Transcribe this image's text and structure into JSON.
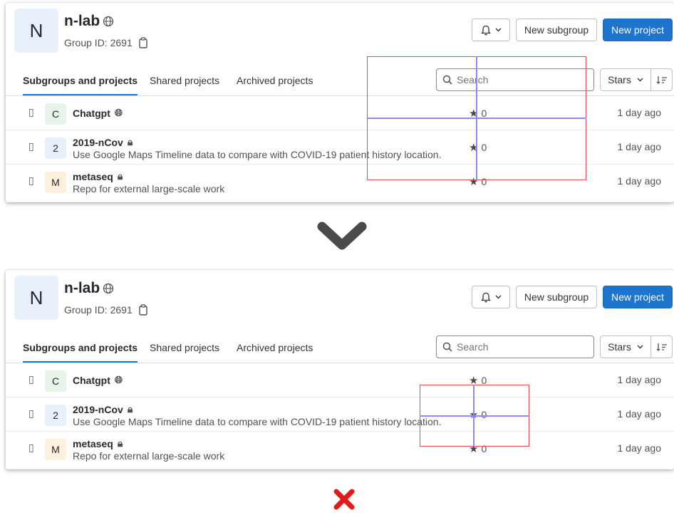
{
  "group": {
    "initial": "N",
    "name": "n-lab",
    "id_text": "Group ID: 2691"
  },
  "header_buttons": {
    "new_subgroup": "New subgroup",
    "new_project": "New project"
  },
  "tabs": [
    {
      "label": "Subgroups and projects",
      "active": true
    },
    {
      "label": "Shared projects",
      "active": false
    },
    {
      "label": "Archived projects",
      "active": false
    }
  ],
  "search": {
    "placeholder": "Search"
  },
  "sort": {
    "label": "Stars"
  },
  "projects": [
    {
      "initial": "C",
      "name": "Chatgpt",
      "visibility": "globe-icon",
      "description": "",
      "stars": "0",
      "updated": "1 day ago",
      "avatar_color": "#e6f4ea"
    },
    {
      "initial": "2",
      "name": "2019-nCov",
      "visibility": "lock-icon",
      "description": "Use Google Maps Timeline data to compare with COVID-19 patient history location.",
      "stars": "0",
      "updated": "1 day ago",
      "avatar_color": "#e8f0fb"
    },
    {
      "initial": "M",
      "name": "metaseq",
      "visibility": "lock-icon",
      "description": "Repo for external large-scale work",
      "stars": "0",
      "updated": "1 day ago",
      "avatar_color": "#fdf1dd"
    }
  ],
  "colors": {
    "primary": "#1f75cb",
    "annotation_box": "#e8474d",
    "annotation_line": "#8c8cf0",
    "chevron": "#4a4a4a",
    "cross": "#e11b1b"
  }
}
